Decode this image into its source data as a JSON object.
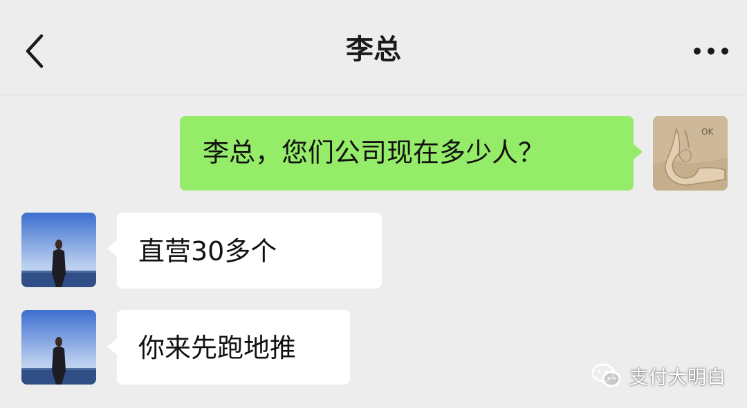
{
  "header": {
    "title": "李总",
    "back_icon": "chevron-left-icon",
    "more_icon": "more-dots-icon"
  },
  "messages": [
    {
      "side": "right",
      "text": "李总，您们公司现在多少人？",
      "avatar": "ok-hand-avatar",
      "avatar_text": "OK"
    },
    {
      "side": "left",
      "text": "直营30多个",
      "avatar": "person-sea-avatar"
    },
    {
      "side": "left",
      "text": "你来先跑地推",
      "avatar": "person-sea-avatar"
    }
  ],
  "watermark": {
    "icon": "wechat-icon",
    "text": "支付大明白"
  },
  "colors": {
    "background": "#ededed",
    "self_bubble": "#95ec69",
    "other_bubble": "#ffffff"
  }
}
